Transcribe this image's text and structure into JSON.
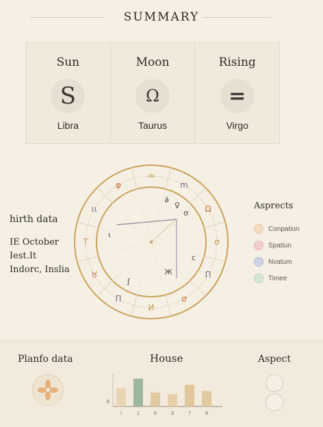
{
  "header": {
    "title": "SUMMARY"
  },
  "big_three": [
    {
      "label": "Sun",
      "glyph": "S",
      "sign": "Libra"
    },
    {
      "label": "Moon",
      "glyph": "Ω",
      "sign": "Taurus"
    },
    {
      "label": "Rising",
      "glyph": "=",
      "sign": "Virgo"
    }
  ],
  "wheel": {
    "outer_glyphs": [
      "♒",
      "m",
      "Ω",
      "σ",
      "Π",
      "σ",
      "И",
      "Π",
      "♉",
      "T",
      "ιι",
      "φ"
    ],
    "inner_glyphs": [
      "á",
      "♀",
      "σ",
      "ι",
      "ʃ",
      "с",
      "Ж"
    ],
    "accent_color": "#c9a25a"
  },
  "birth": {
    "heading": "hirth data",
    "date": "IE October",
    "time": "Iest.It",
    "place": "Indorc, Inslia"
  },
  "aspects": {
    "heading": "Asprects",
    "items": [
      {
        "label": "Conpation",
        "color": "#f1dcc2"
      },
      {
        "label": "Spatiun",
        "color": "#f2cfcf"
      },
      {
        "label": "Nvatum",
        "color": "#cfd3e8"
      },
      {
        "label": "Timee",
        "color": "#d5e6d3"
      }
    ]
  },
  "bottom": {
    "plan_title": "Planfo data",
    "house_title": "House",
    "aspect_title": "Aspect"
  },
  "chart_data": {
    "type": "bar",
    "categories": [
      "i",
      "1",
      "0",
      "3",
      "7",
      "9"
    ],
    "values": [
      6,
      9,
      4.5,
      4,
      7,
      5
    ],
    "colors": [
      "#e7d5b4",
      "#9db69e",
      "#e2caa0",
      "#e7d0a8",
      "#e2c79c",
      "#e2caa0"
    ],
    "ytick": "8"
  }
}
